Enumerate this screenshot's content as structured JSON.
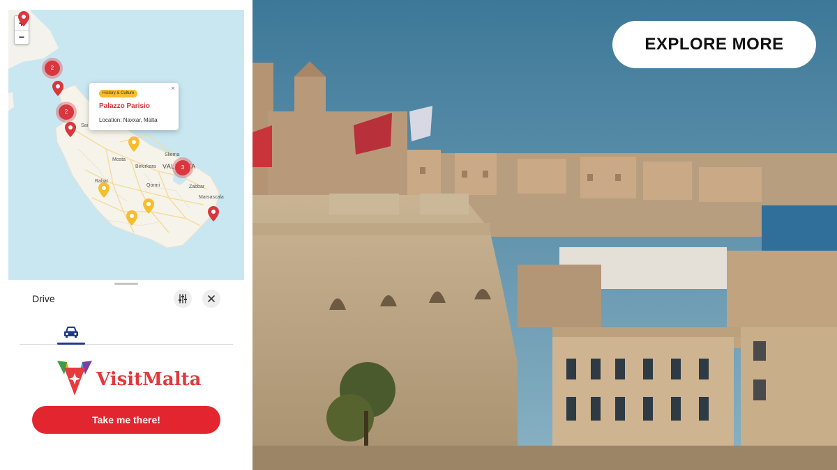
{
  "map": {
    "zoom_in": "+",
    "zoom_out": "−",
    "labels": {
      "sliema": "Sliema",
      "mosta": "Mosta",
      "birkirkara": "Birkirkara",
      "valletta": "VALLETTA",
      "rabat": "Rabat",
      "qormi": "Qormi",
      "zabbar": "Zabbar",
      "marsascala": "Marsascala",
      "st_pauls": "Sai"
    },
    "clusters": [
      "2",
      "2",
      "3"
    ],
    "popup": {
      "category": "History & Culture",
      "title": "Palazzo Parisio",
      "location": "Location: Naxxar, Malta",
      "close": "×"
    }
  },
  "directions": {
    "title": "Drive",
    "cta": "Take me there!"
  },
  "brand": {
    "logo_text": "VisitMalta",
    "red": "#e32530",
    "pin_yellow": "#f6be2d",
    "pin_red": "#d9363e"
  },
  "hero": {
    "button": "EXPLORE MORE"
  }
}
